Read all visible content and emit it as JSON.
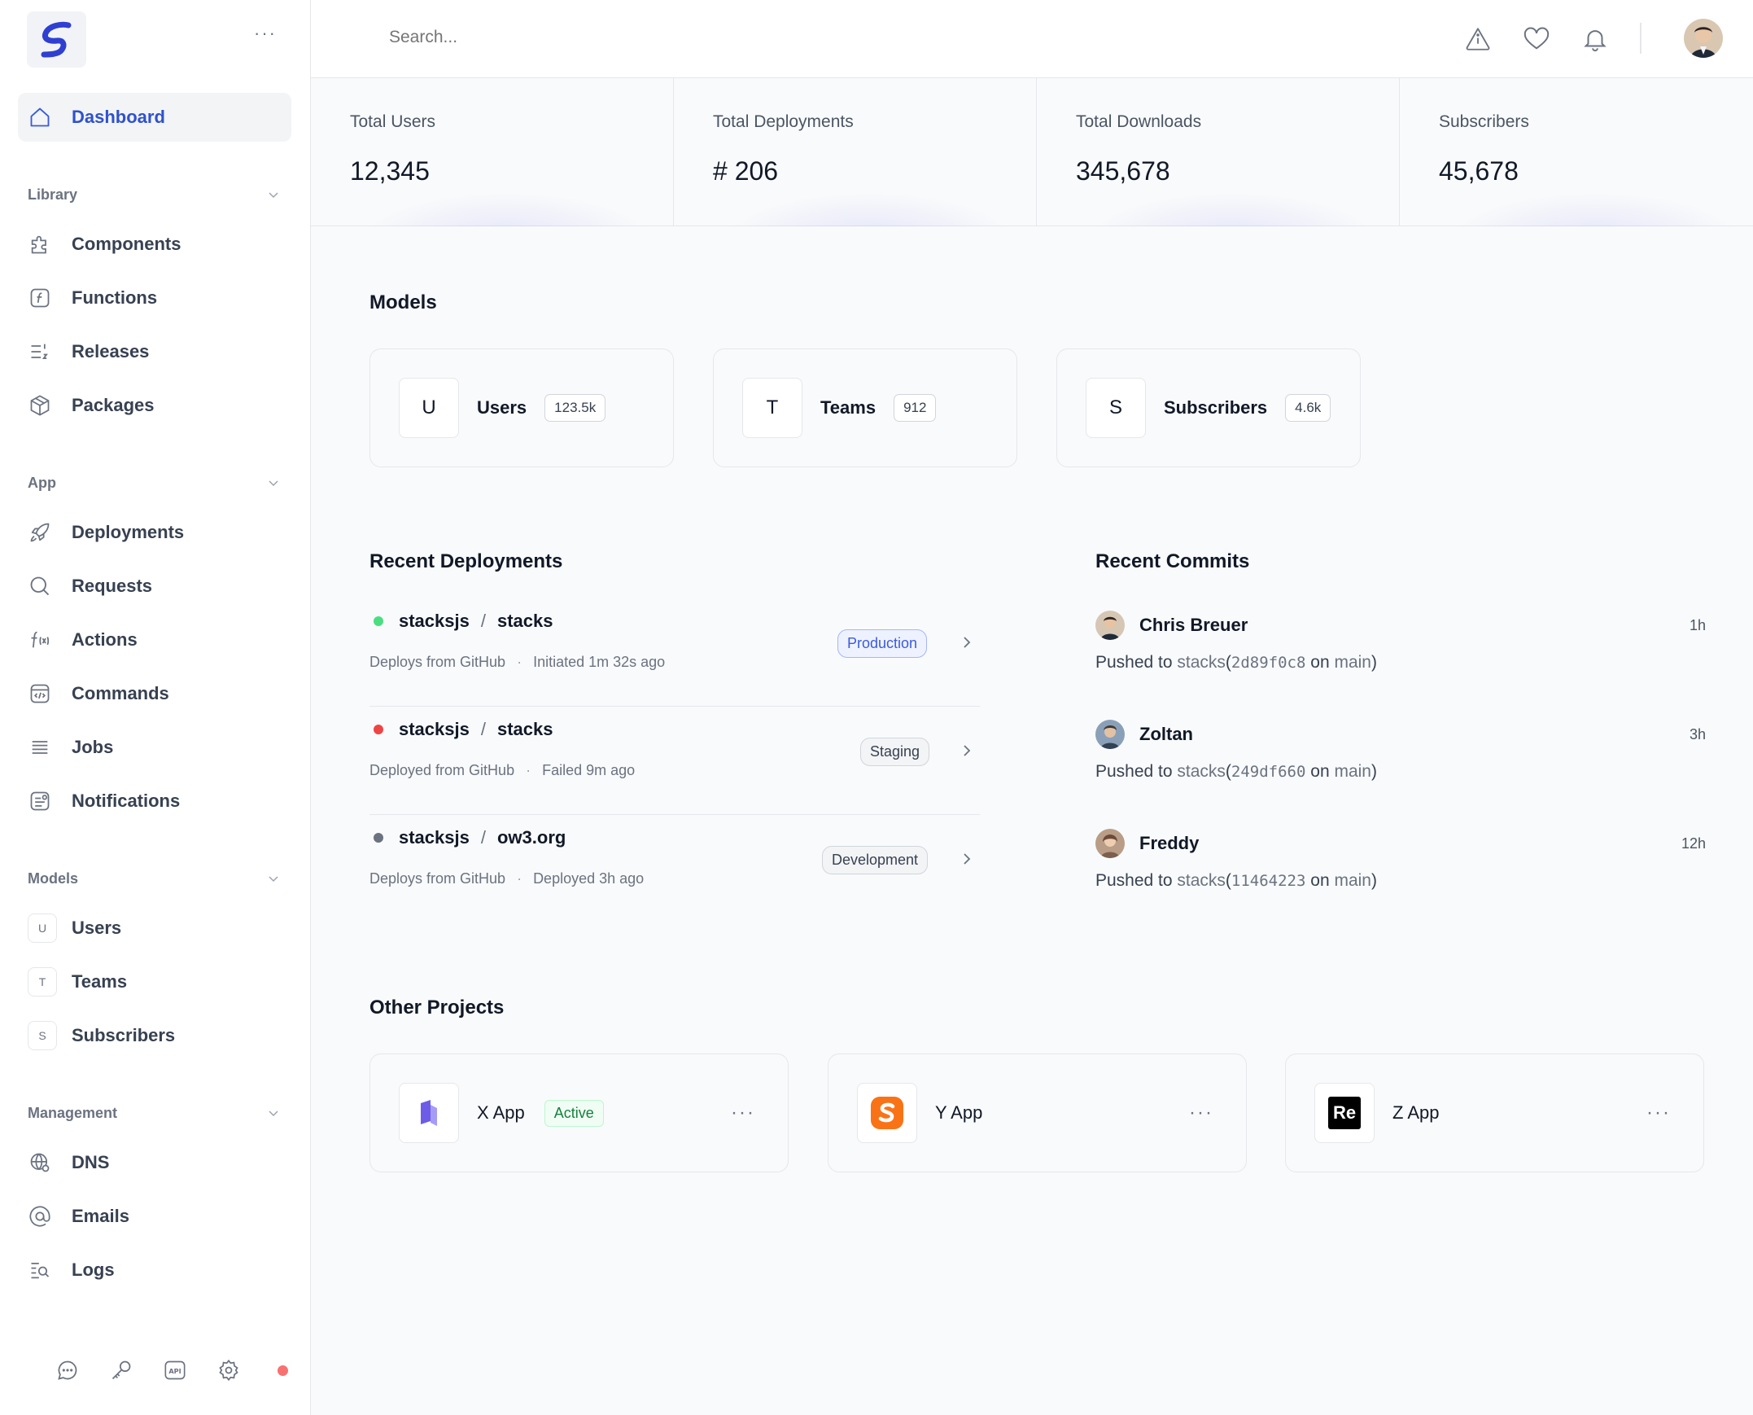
{
  "sidebar": {
    "dashboard": "Dashboard",
    "library": {
      "title": "Library",
      "items": [
        "Components",
        "Functions",
        "Releases",
        "Packages"
      ]
    },
    "app": {
      "title": "App",
      "items": [
        "Deployments",
        "Requests",
        "Actions",
        "Commands",
        "Jobs",
        "Notifications"
      ]
    },
    "models": {
      "title": "Models",
      "items": [
        {
          "letter": "U",
          "label": "Users"
        },
        {
          "letter": "T",
          "label": "Teams"
        },
        {
          "letter": "S",
          "label": "Subscribers"
        }
      ]
    },
    "management": {
      "title": "Management",
      "items": [
        "DNS",
        "Emails",
        "Logs"
      ]
    }
  },
  "topbar": {
    "search_placeholder": "Search..."
  },
  "stats": [
    {
      "label": "Total Users",
      "value": "12,345"
    },
    {
      "label": "Total Deployments",
      "value": "# 206"
    },
    {
      "label": "Total Downloads",
      "value": "345,678"
    },
    {
      "label": "Subscribers",
      "value": "45,678"
    }
  ],
  "models_section": {
    "title": "Models",
    "cards": [
      {
        "letter": "U",
        "name": "Users",
        "count": "123.5k"
      },
      {
        "letter": "T",
        "name": "Teams",
        "count": "912"
      },
      {
        "letter": "S",
        "name": "Subscribers",
        "count": "4.6k"
      }
    ]
  },
  "deployments": {
    "title": "Recent Deployments",
    "items": [
      {
        "org": "stacksjs",
        "repo": "stacks",
        "source": "Deploys from GitHub",
        "status": "Initiated 1m 32s ago",
        "env": "Production",
        "dot_color": "#4ade80"
      },
      {
        "org": "stacksjs",
        "repo": "stacks",
        "source": "Deployed from GitHub",
        "status": "Failed 9m ago",
        "env": "Staging",
        "dot_color": "#ef4444"
      },
      {
        "org": "stacksjs",
        "repo": "ow3.org",
        "source": "Deploys from GitHub",
        "status": "Deployed 3h ago",
        "env": "Development",
        "dot_color": "#6b7280"
      }
    ]
  },
  "commits": {
    "title": "Recent Commits",
    "items": [
      {
        "author": "Chris Breuer",
        "time": "1h",
        "prefix": "Pushed to ",
        "repo": "stacks",
        "hash": "2d89f0c8",
        "on": " on ",
        "branch": "main"
      },
      {
        "author": "Zoltan",
        "time": "3h",
        "prefix": "Pushed to ",
        "repo": "stacks",
        "hash": "249df660",
        "on": " on ",
        "branch": "main"
      },
      {
        "author": "Freddy",
        "time": "12h",
        "prefix": "Pushed to ",
        "repo": "stacks",
        "hash": "11464223",
        "on": " on ",
        "branch": "main"
      }
    ]
  },
  "projects": {
    "title": "Other Projects",
    "items": [
      {
        "name": "X App",
        "status": "Active",
        "logo_text": ""
      },
      {
        "name": "Y App",
        "status": "",
        "logo_text": ""
      },
      {
        "name": "Z App",
        "status": "",
        "logo_text": "Re"
      }
    ]
  },
  "colors": {
    "accent": "#3b5bdb",
    "active_green": "#15803d"
  }
}
